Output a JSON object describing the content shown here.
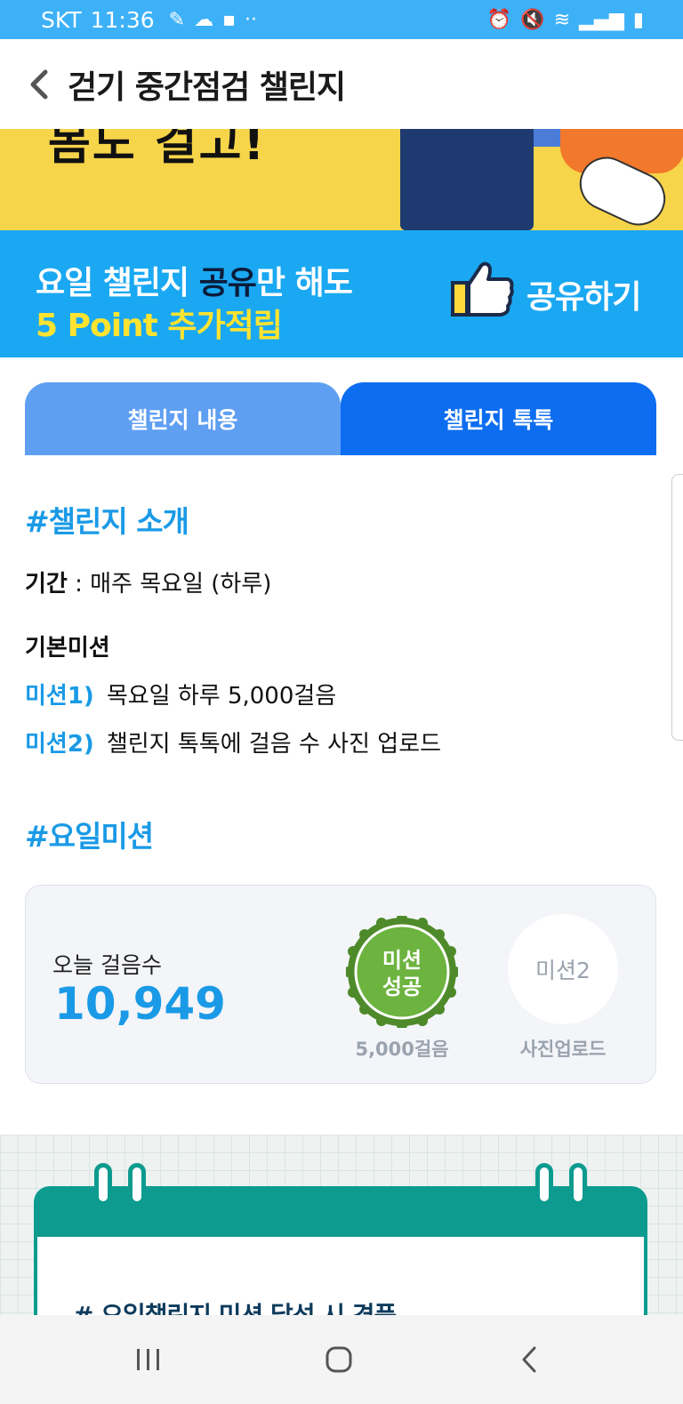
{
  "status_bar": {
    "carrier": "SKT",
    "time": "11:36"
  },
  "header": {
    "title": "걷기 중간점검 챌린지"
  },
  "banner_top": {
    "partial_text": "몸도 걸고!"
  },
  "banner_share": {
    "line1_prefix": "요일 챌린지 ",
    "line1_emphasis": "공유",
    "line1_suffix": "만 해도",
    "line2": "5 Point 추가적립",
    "share_label": "공유하기"
  },
  "tabs": [
    {
      "label": "챌린지 내용",
      "active": false
    },
    {
      "label": "챌린지 톡톡",
      "active": true
    }
  ],
  "intro": {
    "title": "#챌린지 소개",
    "period_label": "기간",
    "period_value": " : 매주 목요일 (하루)",
    "basic_mission_label": "기본미션",
    "missions": [
      {
        "tag": "미션1)",
        "text": "목요일 하루 5,000걸음"
      },
      {
        "tag": "미션2)",
        "text": "챌린지 톡톡에 걸음 수 사진 업로드"
      }
    ]
  },
  "day_mission": {
    "title": "#요일미션",
    "steps_label": "오늘 걸음수",
    "steps_value": "10,949",
    "badge1_text_top": "미션",
    "badge1_text_bottom": "성공",
    "badge1_caption": "5,000걸음",
    "badge2_text": "미션2",
    "badge2_caption": "사진업로드"
  },
  "calendar": {
    "title": "# 요일챌린지 미션 달성 시 경품"
  },
  "colors": {
    "accent": "#1a9ae6",
    "status_bar": "#3db1f7",
    "tab_active": "#0d6df0",
    "tab_inactive": "#5f9ff2",
    "badge_green": "#6cb33f",
    "calendar_teal": "#0e9b8f"
  }
}
